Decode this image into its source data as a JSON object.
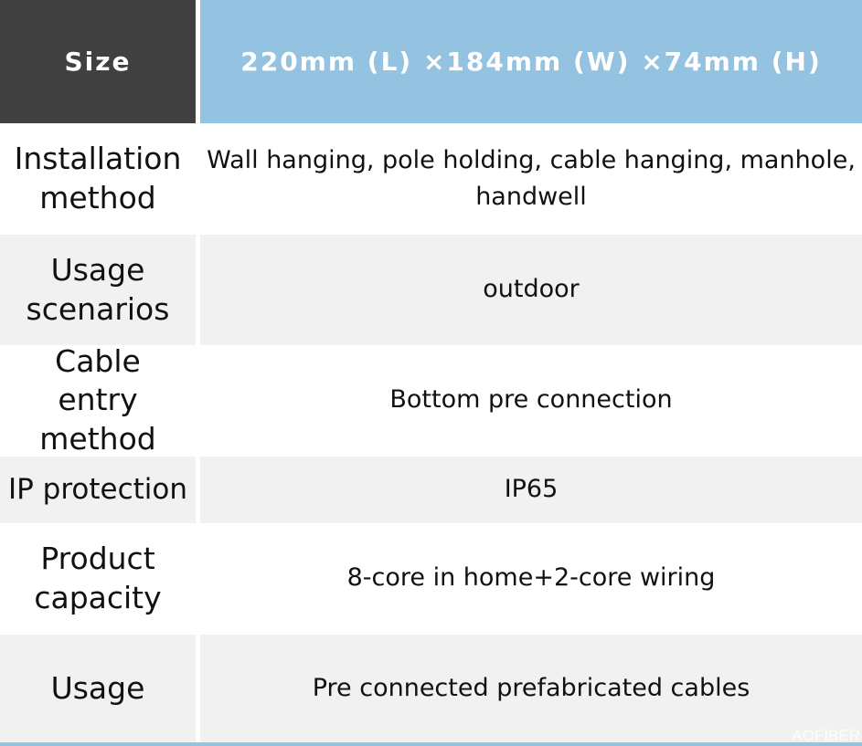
{
  "header": {
    "label": "Size",
    "value": "220mm (L) ×184mm (W) ×74mm (H)"
  },
  "rows": [
    {
      "label": "Installation method",
      "value": "Wall hanging, pole holding, cable hanging, manhole, handwell"
    },
    {
      "label": "Usage scenarios",
      "value": "outdoor"
    },
    {
      "label": "Cable entry method",
      "value": "Bottom pre connection"
    },
    {
      "label": "IP protection",
      "value": "IP65"
    },
    {
      "label": "Product capacity",
      "value": "8-core in home+2-core wiring"
    },
    {
      "label": "Usage",
      "value": "Pre connected prefabricated cables"
    }
  ],
  "watermark": "AOFIBER",
  "colors": {
    "header_label_bg": "#404040",
    "header_value_bg": "#93c3e0",
    "row_alt_bg": "#f1f1f1"
  }
}
